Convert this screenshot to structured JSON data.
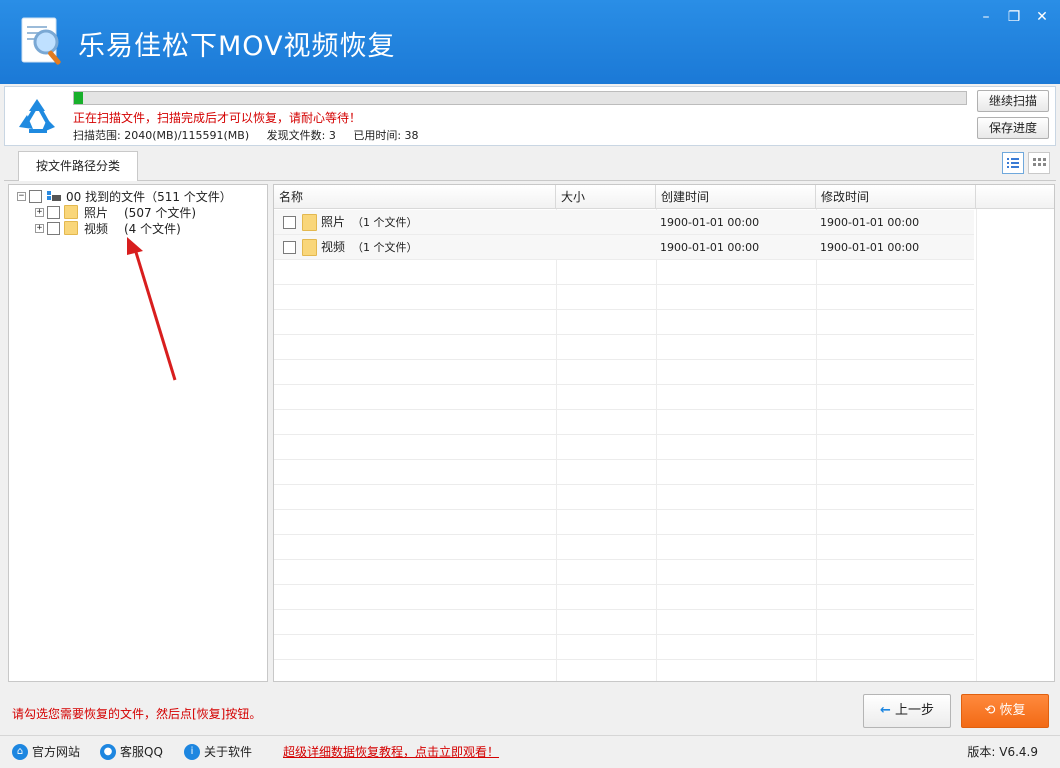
{
  "app": {
    "title": "乐易佳松下MOV视频恢复"
  },
  "scan": {
    "progress": 0.01,
    "message": "正在扫描文件，扫描完成后才可以恢复，请耐心等待！",
    "range": "扫描范围: 2040(MB)/115591(MB)",
    "found": "发现文件数: 3",
    "elapsed": "已用时间: 38",
    "continue_label": "继续扫描",
    "save_label": "保存进度"
  },
  "tabs": [
    {
      "label": "按文件路径分类"
    }
  ],
  "tree": {
    "root": {
      "label": "00 找到的文件（511 个文件）"
    },
    "children": [
      {
        "name": "照片",
        "count": "(507 个文件)"
      },
      {
        "name": "视频",
        "count": "(4 个文件)"
      }
    ]
  },
  "list": {
    "columns": [
      "名称",
      "大小",
      "创建时间",
      "修改时间"
    ],
    "rows": [
      {
        "name": "照片",
        "count": "（1 个文件）",
        "size": "",
        "created": "1900-01-01  00:00",
        "modified": "1900-01-01  00:00"
      },
      {
        "name": "视频",
        "count": "（1 个文件）",
        "size": "",
        "created": "1900-01-01  00:00",
        "modified": "1900-01-01  00:00"
      }
    ]
  },
  "bottom": {
    "hint": "请勾选您需要恢复的文件，然后点[恢复]按钮。",
    "prev_label": "上一步",
    "recover_label": "恢复"
  },
  "footer": {
    "website": "官方网站",
    "qq": "客服QQ",
    "about": "关于软件",
    "tutorial": "超级详细数据恢复教程，点击立即观看！",
    "version": "版本: V6.4.9"
  },
  "colors": {
    "title_bar": "#1e80da",
    "accent_orange": "#f26a15",
    "warning_red": "#d40000",
    "progress_green": "#18b02b"
  },
  "icons": [
    "app-logo-icon",
    "recycle-icon",
    "minimize-icon",
    "restore-icon",
    "close-icon",
    "list-view-icon",
    "grid-view-icon",
    "folder-icon",
    "drive-icon",
    "arrow-left-icon",
    "refresh-icon",
    "home-icon",
    "qq-icon",
    "info-icon"
  ]
}
